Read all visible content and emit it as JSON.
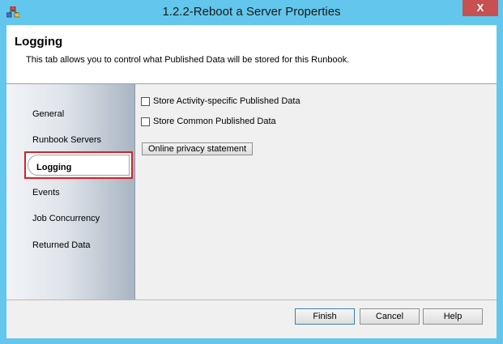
{
  "window": {
    "title": "1.2.2-Reboot a Server Properties",
    "close_glyph": "X",
    "app_icon": "runbook-properties-icon"
  },
  "header": {
    "title": "Logging",
    "description": "This tab allows you to control what Published Data will be stored for this Runbook."
  },
  "sidebar": {
    "items": [
      {
        "label": "General",
        "selected": false
      },
      {
        "label": "Runbook Servers",
        "selected": false
      },
      {
        "label": "Logging",
        "selected": true
      },
      {
        "label": "Events",
        "selected": false
      },
      {
        "label": "Job Concurrency",
        "selected": false
      },
      {
        "label": "Returned Data",
        "selected": false
      }
    ],
    "selected_outline_color": "#d82027"
  },
  "content": {
    "checkboxes": [
      {
        "label": "Store Activity-specific Published Data",
        "checked": false
      },
      {
        "label": "Store Common Published Data",
        "checked": false
      }
    ],
    "privacy_button_label": "Online privacy statement"
  },
  "footer": {
    "finish_label": "Finish",
    "cancel_label": "Cancel",
    "help_label": "Help"
  },
  "colors": {
    "window_frame": "#63c6ec",
    "close_button": "#c75050"
  }
}
